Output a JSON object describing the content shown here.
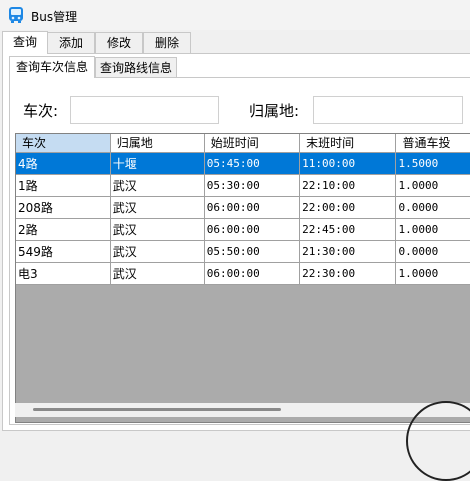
{
  "window": {
    "title": "Bus管理"
  },
  "main_tabs": [
    {
      "label": "查询",
      "active": true
    },
    {
      "label": "添加",
      "active": false
    },
    {
      "label": "修改",
      "active": false
    },
    {
      "label": "删除",
      "active": false
    }
  ],
  "sub_tabs": [
    {
      "label": "查询车次信息",
      "active": true
    },
    {
      "label": "查询路线信息",
      "active": false
    }
  ],
  "search": {
    "bus_no_label": "车次:",
    "bus_no_value": "",
    "owner_label": "归属地:",
    "owner_value": ""
  },
  "grid": {
    "columns": [
      "车次",
      "归属地",
      "始班时间",
      "末班时间",
      "普通车投"
    ],
    "selected_row": 0,
    "rows": [
      [
        "4路",
        "十堰",
        "05:45:00",
        "11:00:00",
        "1.5000"
      ],
      [
        "1路",
        "武汉",
        "05:30:00",
        "22:10:00",
        "1.0000"
      ],
      [
        "208路",
        "武汉",
        "06:00:00",
        "22:00:00",
        "0.0000"
      ],
      [
        "2路",
        "武汉",
        "06:00:00",
        "22:45:00",
        "1.0000"
      ],
      [
        "549路",
        "武汉",
        "05:50:00",
        "21:30:00",
        "0.0000"
      ],
      [
        "电3",
        "武汉",
        "06:00:00",
        "22:30:00",
        "1.0000"
      ]
    ]
  },
  "colors": {
    "selection": "#0078d7",
    "header_highlight": "#c5dcf2",
    "grid_background": "#ababab"
  }
}
